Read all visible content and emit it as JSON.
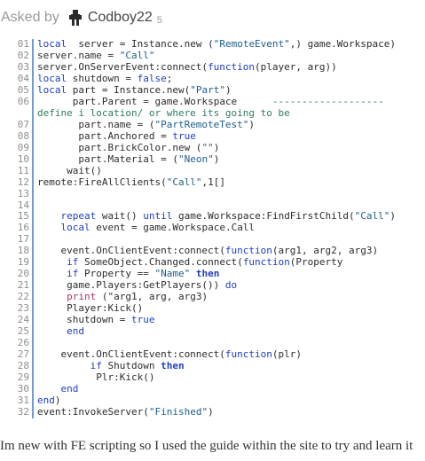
{
  "header": {
    "asked_by": "Asked by",
    "username": "Codboy22",
    "reputation": "5"
  },
  "code_lines": [
    {
      "n": "01",
      "parts": [
        [
          "kw",
          "local"
        ],
        [
          "",
          "  server = Instance.new ("
        ],
        [
          "str",
          "\"RemoteEvent\""
        ],
        [
          "",
          ",) game.Workspace)"
        ]
      ]
    },
    {
      "n": "02",
      "parts": [
        [
          "",
          "server.name = "
        ],
        [
          "str",
          "\"Call\""
        ]
      ]
    },
    {
      "n": "03",
      "parts": [
        [
          "",
          "server.OnServerEvent:connect("
        ],
        [
          "kw",
          "function"
        ],
        [
          "",
          "(player, arg))"
        ]
      ]
    },
    {
      "n": "04",
      "parts": [
        [
          "kw",
          "local"
        ],
        [
          "",
          " shutdown = "
        ],
        [
          "kw",
          "false"
        ],
        [
          "",
          ";"
        ]
      ]
    },
    {
      "n": "05",
      "parts": [
        [
          "kw",
          "local"
        ],
        [
          "",
          " part = Instance.new("
        ],
        [
          "str",
          "\"Part\""
        ],
        [
          "",
          ")"
        ]
      ]
    },
    {
      "n": "06",
      "wrap": true,
      "parts": [
        [
          "",
          "      part.Parent = game.Workspace      "
        ],
        [
          "cm",
          "------------------- define i location/ or where its going to be"
        ]
      ]
    },
    {
      "n": "07",
      "parts": [
        [
          "",
          "       part.name = ("
        ],
        [
          "str",
          "\"PartRemoteTest\""
        ],
        [
          "",
          ")"
        ]
      ]
    },
    {
      "n": "08",
      "parts": [
        [
          "",
          "       part.Anchored = "
        ],
        [
          "kw",
          "true"
        ]
      ]
    },
    {
      "n": "09",
      "parts": [
        [
          "",
          "       part.BrickColor.new ("
        ],
        [
          "str",
          "\"\""
        ],
        [
          "",
          ")"
        ]
      ]
    },
    {
      "n": "10",
      "parts": [
        [
          "",
          "       part.Material = ("
        ],
        [
          "str",
          "\"Neon\""
        ],
        [
          "",
          ")"
        ]
      ]
    },
    {
      "n": "11",
      "parts": [
        [
          "",
          "     wait()"
        ]
      ]
    },
    {
      "n": "12",
      "parts": [
        [
          "",
          "remote:FireAllClients("
        ],
        [
          "str",
          "\"Call\""
        ],
        [
          "",
          ",1[]"
        ]
      ]
    },
    {
      "n": "13",
      "parts": [
        [
          "",
          ""
        ]
      ]
    },
    {
      "n": "14",
      "parts": [
        [
          "",
          ""
        ]
      ]
    },
    {
      "n": "15",
      "parts": [
        [
          "",
          "    "
        ],
        [
          "kw",
          "repeat"
        ],
        [
          "",
          " wait() "
        ],
        [
          "kw",
          "until"
        ],
        [
          "",
          " game.Workspace:FindFirstChild("
        ],
        [
          "str",
          "\"Call\""
        ],
        [
          "",
          ")"
        ]
      ]
    },
    {
      "n": "16",
      "parts": [
        [
          "",
          "    "
        ],
        [
          "kw",
          "local"
        ],
        [
          "",
          " event = game.Workspace.Call"
        ]
      ]
    },
    {
      "n": "17",
      "parts": [
        [
          "",
          ""
        ]
      ]
    },
    {
      "n": "18",
      "parts": [
        [
          "",
          "    event.OnClientEvent:connect("
        ],
        [
          "kw",
          "function"
        ],
        [
          "",
          "(arg1, arg2, arg3)"
        ]
      ]
    },
    {
      "n": "19",
      "parts": [
        [
          "",
          "     "
        ],
        [
          "kw",
          "if"
        ],
        [
          "",
          " SomeObject.Changed.connect("
        ],
        [
          "kw",
          "function"
        ],
        [
          "",
          "(Property"
        ]
      ]
    },
    {
      "n": "20",
      "parts": [
        [
          "",
          "     "
        ],
        [
          "kw",
          "if"
        ],
        [
          "",
          " Property == "
        ],
        [
          "str",
          "\"Name\""
        ],
        [
          "",
          " "
        ],
        [
          "kwb",
          "then"
        ]
      ]
    },
    {
      "n": "21",
      "parts": [
        [
          "",
          "     game.Players:GetPlayers()) "
        ],
        [
          "kw",
          "do"
        ]
      ]
    },
    {
      "n": "22",
      "parts": [
        [
          "",
          "     "
        ],
        [
          "pr",
          "print"
        ],
        [
          "",
          " (\"arg1, arg, arg3)"
        ]
      ]
    },
    {
      "n": "23",
      "parts": [
        [
          "",
          "     Player:Kick()"
        ]
      ]
    },
    {
      "n": "24",
      "parts": [
        [
          "",
          "     shutdown = "
        ],
        [
          "kw",
          "true"
        ]
      ]
    },
    {
      "n": "25",
      "parts": [
        [
          "",
          "     "
        ],
        [
          "kw",
          "end"
        ]
      ]
    },
    {
      "n": "26",
      "parts": [
        [
          "",
          ""
        ]
      ]
    },
    {
      "n": "27",
      "parts": [
        [
          "",
          "    event.OnClientEvent:connect("
        ],
        [
          "kw",
          "function"
        ],
        [
          "",
          "(plr)"
        ]
      ]
    },
    {
      "n": "28",
      "parts": [
        [
          "",
          "         "
        ],
        [
          "kw",
          "if"
        ],
        [
          "",
          " Shutdown "
        ],
        [
          "kwb",
          "then"
        ]
      ]
    },
    {
      "n": "29",
      "parts": [
        [
          "",
          "          Plr:Kick()"
        ]
      ]
    },
    {
      "n": "30",
      "parts": [
        [
          "",
          "    "
        ],
        [
          "kw",
          "end"
        ]
      ]
    },
    {
      "n": "31",
      "parts": [
        [
          "kw",
          "end"
        ],
        [
          "",
          ")"
        ]
      ]
    },
    {
      "n": "32",
      "parts": [
        [
          "",
          "event:InvokeServer("
        ],
        [
          "str",
          "\"Finished\""
        ],
        [
          "",
          ")"
        ]
      ]
    }
  ],
  "body_text": "Im new with FE scripting so I used the guide within the site to try and learn it"
}
